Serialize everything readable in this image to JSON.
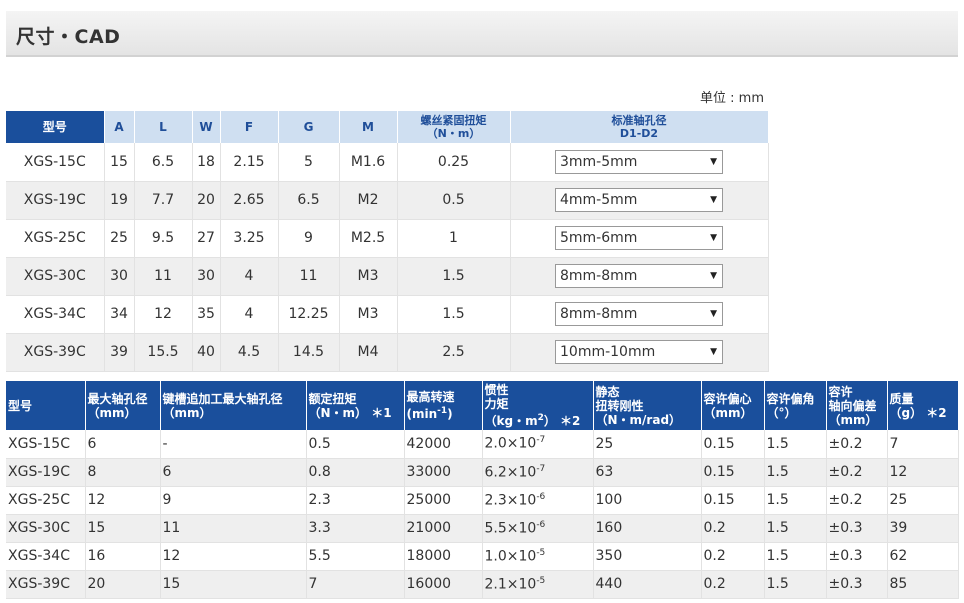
{
  "page": {
    "title": "尺寸・CAD",
    "unit_note": "单位 : mm"
  },
  "table1": {
    "headers": {
      "model": "型号",
      "a": "A",
      "l": "L",
      "w": "W",
      "f": "F",
      "g": "G",
      "m": "M",
      "torque_line1": "螺丝紧固扭矩",
      "torque_line2": "（N・m）",
      "bore_line1": "标准轴孔径",
      "bore_line2": "D1-D2"
    },
    "rows": [
      {
        "model": "XGS-15C",
        "a": "15",
        "l": "6.5",
        "w": "18",
        "f": "2.15",
        "g": "5",
        "m": "M1.6",
        "torque": "0.25",
        "bore": "3mm-5mm"
      },
      {
        "model": "XGS-19C",
        "a": "19",
        "l": "7.7",
        "w": "20",
        "f": "2.65",
        "g": "6.5",
        "m": "M2",
        "torque": "0.5",
        "bore": "4mm-5mm"
      },
      {
        "model": "XGS-25C",
        "a": "25",
        "l": "9.5",
        "w": "27",
        "f": "3.25",
        "g": "9",
        "m": "M2.5",
        "torque": "1",
        "bore": "5mm-6mm"
      },
      {
        "model": "XGS-30C",
        "a": "30",
        "l": "11",
        "w": "30",
        "f": "4",
        "g": "11",
        "m": "M3",
        "torque": "1.5",
        "bore": "8mm-8mm"
      },
      {
        "model": "XGS-34C",
        "a": "34",
        "l": "12",
        "w": "35",
        "f": "4",
        "g": "12.25",
        "m": "M3",
        "torque": "1.5",
        "bore": "8mm-8mm"
      },
      {
        "model": "XGS-39C",
        "a": "39",
        "l": "15.5",
        "w": "40",
        "f": "4.5",
        "g": "14.5",
        "m": "M4",
        "torque": "2.5",
        "bore": "10mm-10mm"
      }
    ]
  },
  "table2": {
    "headers": {
      "model": "型号",
      "max_bore_line1": "最大轴孔径",
      "max_bore_line2": "（mm）",
      "keyway_line1": "键槽追加工最大轴孔径",
      "keyway_line2": "（mm）",
      "rated_torque_line1": "额定扭矩",
      "rated_torque_line2": "（N・m）",
      "rated_torque_note": "＊1",
      "max_speed_line1": "最高转速",
      "max_speed_line2": "(min",
      "max_speed_sup": "-1",
      "max_speed_close": ")",
      "inertia_line1": "惯性",
      "inertia_line2": "力矩",
      "inertia_line3": "（kg・m",
      "inertia_sup": "2",
      "inertia_close": "）",
      "inertia_note": "＊2",
      "stiffness_line1": "静态",
      "stiffness_line2": "扭转刚性",
      "stiffness_line3": "（N・m/rad）",
      "eccentric_line1": "容许偏心",
      "eccentric_line2": "（mm）",
      "angle_line1": "容许偏角",
      "angle_line2": "（°）",
      "axial_line1": "容许",
      "axial_line2": "轴向偏差",
      "axial_line3": "（mm）",
      "mass_line1": "质量",
      "mass_line2": "（g）",
      "mass_note": "＊2"
    },
    "rows": [
      {
        "model": "XGS-15C",
        "max_bore": "6",
        "keyway": "-",
        "rated_torque": "0.5",
        "max_speed": "42000",
        "inertia_base": "2.0×10",
        "inertia_exp": "-7",
        "stiffness": "25",
        "eccentric": "0.15",
        "angle": "1.5",
        "axial": "±0.2",
        "mass": "7"
      },
      {
        "model": "XGS-19C",
        "max_bore": "8",
        "keyway": "6",
        "rated_torque": "0.8",
        "max_speed": "33000",
        "inertia_base": "6.2×10",
        "inertia_exp": "-7",
        "stiffness": "63",
        "eccentric": "0.15",
        "angle": "1.5",
        "axial": "±0.2",
        "mass": "12"
      },
      {
        "model": "XGS-25C",
        "max_bore": "12",
        "keyway": "9",
        "rated_torque": "2.3",
        "max_speed": "25000",
        "inertia_base": "2.3×10",
        "inertia_exp": "-6",
        "stiffness": "100",
        "eccentric": "0.15",
        "angle": "1.5",
        "axial": "±0.2",
        "mass": "25"
      },
      {
        "model": "XGS-30C",
        "max_bore": "15",
        "keyway": "11",
        "rated_torque": "3.3",
        "max_speed": "21000",
        "inertia_base": "5.5×10",
        "inertia_exp": "-6",
        "stiffness": "160",
        "eccentric": "0.2",
        "angle": "1.5",
        "axial": "±0.3",
        "mass": "39"
      },
      {
        "model": "XGS-34C",
        "max_bore": "16",
        "keyway": "12",
        "rated_torque": "5.5",
        "max_speed": "18000",
        "inertia_base": "1.0×10",
        "inertia_exp": "-5",
        "stiffness": "350",
        "eccentric": "0.2",
        "angle": "1.5",
        "axial": "±0.3",
        "mass": "62"
      },
      {
        "model": "XGS-39C",
        "max_bore": "20",
        "keyway": "15",
        "rated_torque": "7",
        "max_speed": "16000",
        "inertia_base": "2.1×10",
        "inertia_exp": "-5",
        "stiffness": "440",
        "eccentric": "0.2",
        "angle": "1.5",
        "axial": "±0.3",
        "mass": "85"
      }
    ]
  }
}
